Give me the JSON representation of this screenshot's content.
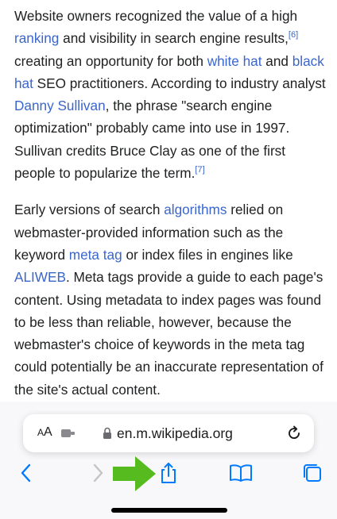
{
  "article": {
    "paragraph1": {
      "t1": "Website owners recognized the value of a high ",
      "link_ranking": "ranking",
      "t2": " and visibility in search engine results,",
      "ref6": "[6]",
      "t3": " creating an opportunity for both ",
      "link_white_hat": "white hat",
      "t4": " and ",
      "link_black_hat": "black hat",
      "t5": " SEO practitioners. According to industry analyst ",
      "link_danny": "Danny Sullivan",
      "t6": ", the phrase \"search engine optimization\" probably came into use in 1997. Sullivan credits Bruce Clay as one of the first people to popularize the term.",
      "ref7": "[7]"
    },
    "paragraph2": {
      "t1": "Early versions of search ",
      "link_algorithms": "algorithms",
      "t2": " relied on webmaster-provided information such as the keyword ",
      "link_meta_tag": "meta tag",
      "t3": " or index files in engines like ",
      "link_aliweb": "ALIWEB",
      "t4": ". Meta tags provide a guide to each page's content. Using metadata to index pages was found to be less than reliable, however, because the webmaster's choice of keywords in the meta tag could potentially be an inaccurate representation of the site's actual content."
    }
  },
  "url_bar": {
    "aa_small": "A",
    "aa_large": "A",
    "url": "en.m.wikipedia.org"
  },
  "icons": {
    "extension": "puzzle-icon",
    "lock": "lock-icon",
    "reload": "reload-icon",
    "back": "chevron-left-icon",
    "forward": "chevron-right-icon",
    "share": "share-icon",
    "bookmarks": "book-icon",
    "tabs": "tabs-icon",
    "annotation": "green-arrow-icon"
  },
  "colors": {
    "link": "#3a66cc",
    "ios_blue": "#007aff",
    "arrow_green": "#55bb1e"
  }
}
